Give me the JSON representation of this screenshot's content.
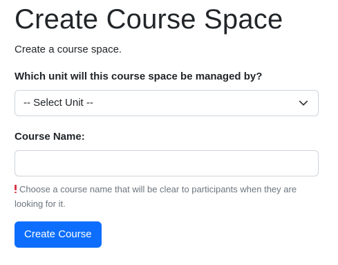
{
  "page": {
    "title": "Create Course Space",
    "subtitle": "Create a course space."
  },
  "unit_field": {
    "label": "Which unit will this course space be managed by?",
    "selected": "-- Select Unit --"
  },
  "course_name_field": {
    "label": "Course Name:",
    "value": "",
    "help_text": "Choose a course name that will be clear to participants when they are looking for it."
  },
  "actions": {
    "submit_label": "Create Course"
  },
  "colors": {
    "primary": "#0d6efd",
    "warning_mark": "#dc3545",
    "help_text": "#6c757d",
    "border": "#ced4da"
  },
  "icons": {
    "select_indicator": "chevron-down-icon",
    "help_marker": "exclamation-icon"
  }
}
